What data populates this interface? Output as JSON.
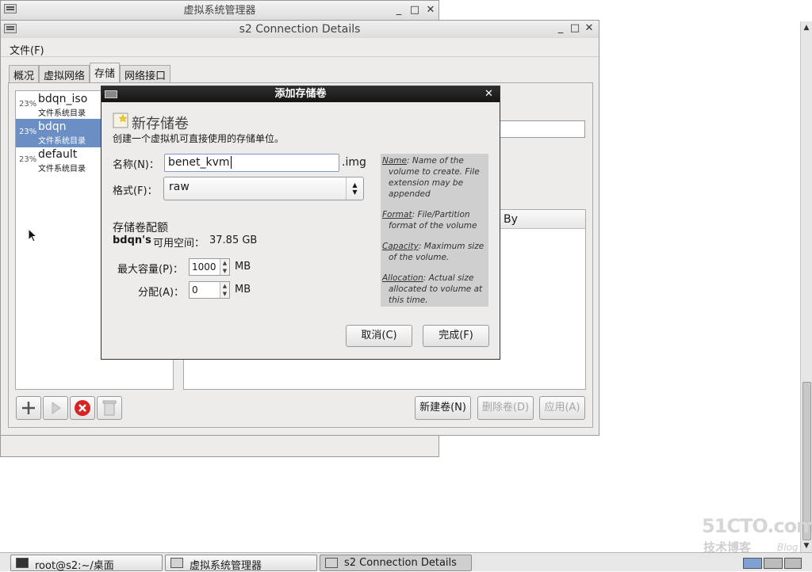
{
  "bg_window": {
    "title": "虚拟系统管理器"
  },
  "main_window": {
    "title": "s2 Connection Details",
    "menu": {
      "file": "文件(F)"
    },
    "tabs": [
      {
        "label": "概况"
      },
      {
        "label": "虚拟网络"
      },
      {
        "label": "存储"
      },
      {
        "label": "网络接口"
      }
    ],
    "pools": [
      {
        "usage": "23%",
        "name": "bdqn_iso",
        "type": "文件系统目录"
      },
      {
        "usage": "23%",
        "name": "bdqn",
        "type": "文件系统目录"
      },
      {
        "usage": "23%",
        "name": "default",
        "type": "文件系统目录"
      }
    ],
    "volume_column": "By",
    "buttons": {
      "new_volume": "新建卷(N)",
      "delete_volume": "删除卷(D)",
      "apply": "应用(A)"
    }
  },
  "dialog": {
    "title": "添加存储卷",
    "heading": "新存储卷",
    "description": "创建一个虚拟机可直接使用的存储单位。",
    "name_label": "名称(N)：",
    "name_value": "benet_kvm",
    "name_suffix": ".img",
    "format_label": "格式(F)：",
    "format_value": "raw",
    "alloc_section": "存储卷配额",
    "pool_name": "bdqn's",
    "free_space_label": "可用空间：",
    "free_space": "37.85 GB",
    "max_capacity_label": "最大容量(P)：",
    "max_capacity": "1000",
    "allocation_label": "分配(A)：",
    "allocation": "0",
    "unit": "MB",
    "help": {
      "name_term": "Name",
      "name_text": ": Name of the volume to create. File extension may be appended",
      "format_term": "Format",
      "format_text": ": File/Partition format of the volume",
      "capacity_term": "Capacity",
      "capacity_text": ": Maximum size of the volume.",
      "allocation_term": "Allocation",
      "allocation_text": ": Actual size allocated to volume at this time."
    },
    "cancel": "取消(C)",
    "finish": "完成(F)"
  },
  "taskbar": [
    {
      "label": "root@s2:~/桌面"
    },
    {
      "label": "虚拟系统管理器"
    },
    {
      "label": "s2 Connection Details"
    }
  ],
  "watermark": {
    "site": "51CTO.com",
    "tagline": "技术博客",
    "blog": "Blog"
  }
}
